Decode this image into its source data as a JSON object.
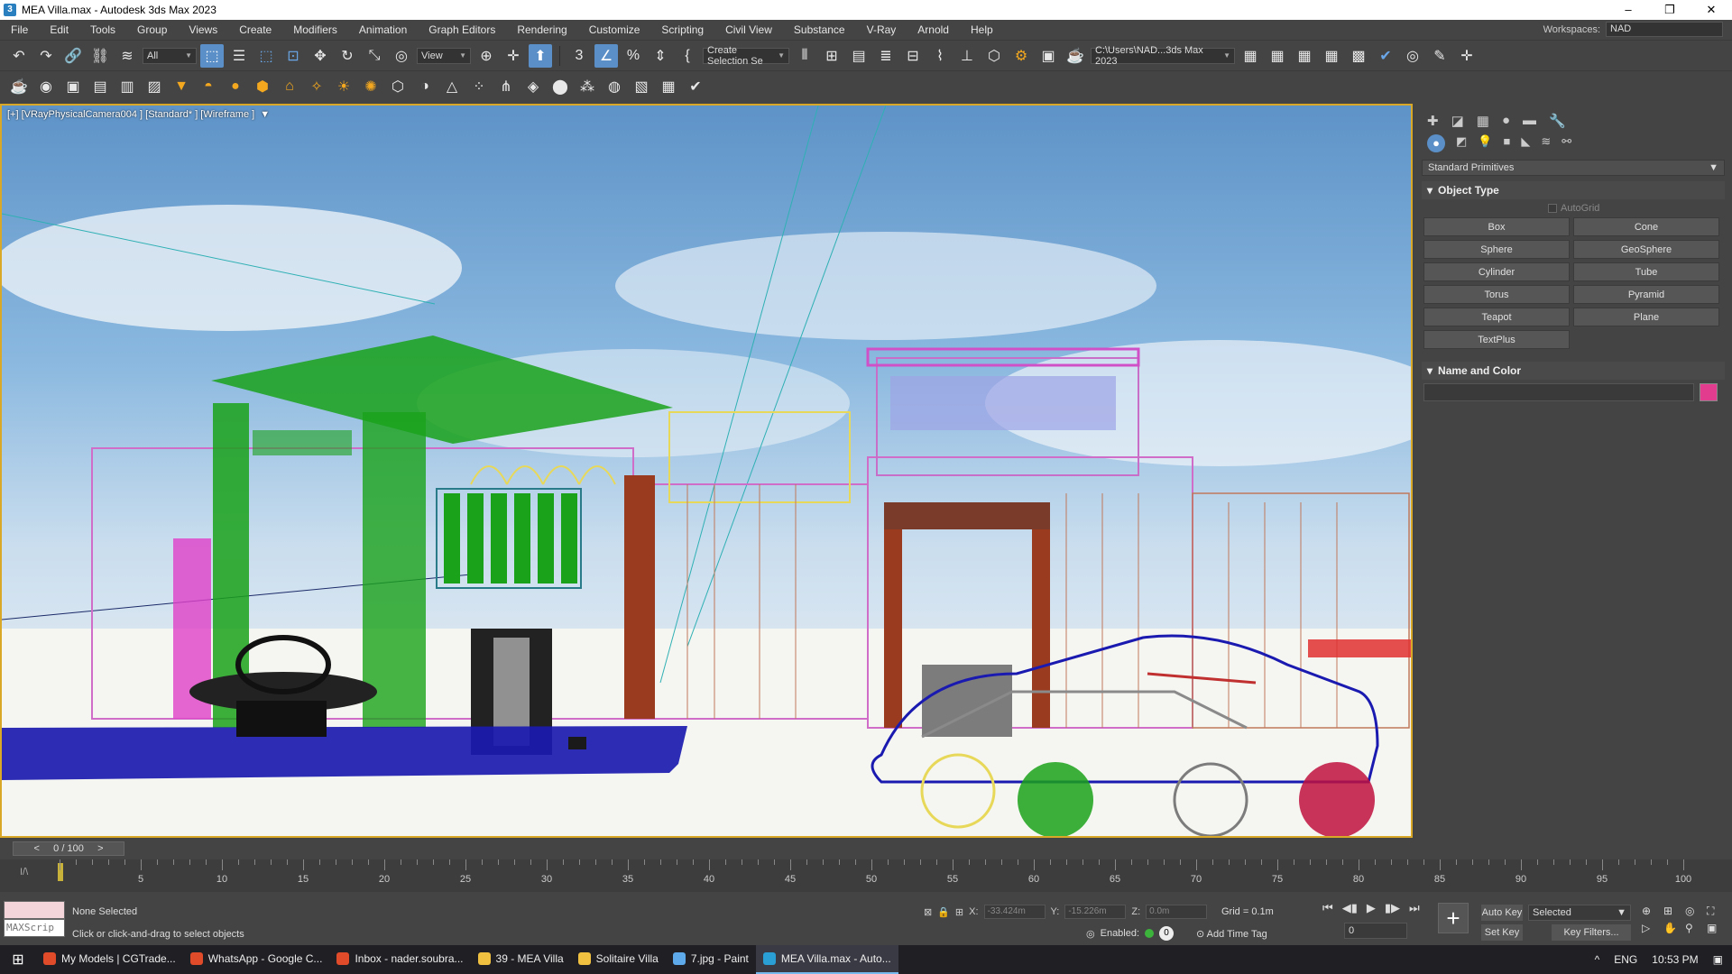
{
  "window": {
    "title": "MEA Villa.max - Autodesk 3ds Max 2023",
    "minimize": "–",
    "maximize": "❐",
    "close": "✕"
  },
  "menu": [
    "File",
    "Edit",
    "Tools",
    "Group",
    "Views",
    "Create",
    "Modifiers",
    "Animation",
    "Graph Editors",
    "Rendering",
    "Customize",
    "Scripting",
    "Civil View",
    "Substance",
    "V-Ray",
    "Arnold",
    "Help"
  ],
  "workspace": {
    "label": "Workspaces:",
    "value": "NAD"
  },
  "toolbar": {
    "filter": "All",
    "ref_coord": "View",
    "selection_set": "Create Selection Se",
    "project_path": "C:\\Users\\NAD...3ds Max 2023"
  },
  "viewport": {
    "label": "[+] [VRayPhysicalCamera004 ] [Standard* ] [Wireframe ]"
  },
  "command_panel": {
    "category": "Standard Primitives",
    "object_type": "Object Type",
    "autogrid": "AutoGrid",
    "primitives": [
      "Box",
      "Cone",
      "Sphere",
      "GeoSphere",
      "Cylinder",
      "Tube",
      "Torus",
      "Pyramid",
      "Teapot",
      "Plane",
      "TextPlus"
    ],
    "name_and_color": "Name and Color",
    "object_color": "#e23c8e"
  },
  "timeslider": {
    "position": "0 / 100",
    "prev": "<",
    "next": ">"
  },
  "trackbar": {
    "ticks": [
      5,
      10,
      15,
      20,
      25,
      30,
      35,
      40,
      45,
      50,
      55,
      60,
      65,
      70,
      75,
      80,
      85,
      90,
      95,
      100
    ]
  },
  "status": {
    "maxscript": "MAXScrip",
    "selection": "None Selected",
    "prompt": "Click or click-and-drag to select objects",
    "x_label": "X:",
    "x_value": "-33.424m",
    "y_label": "Y:",
    "y_value": "-15.226m",
    "z_label": "Z:",
    "z_value": "0.0m",
    "grid": "Grid = 0.1m",
    "enabled_label": "Enabled:",
    "enabled_value": "0",
    "add_time_tag": "Add Time Tag",
    "frame": "0",
    "auto_key": "Auto Key",
    "set_key": "Set Key",
    "key_mode": "Selected",
    "key_filters": "Key Filters..."
  },
  "taskbar": {
    "tasks": [
      {
        "label": "My Models | CGTrade...",
        "color": "#e04b2a"
      },
      {
        "label": "WhatsApp - Google C...",
        "color": "#e04b2a"
      },
      {
        "label": "Inbox - nader.soubra...",
        "color": "#e04b2a"
      },
      {
        "label": "39 - MEA Villa",
        "color": "#f0c040"
      },
      {
        "label": "Solitaire Villa",
        "color": "#f0c040"
      },
      {
        "label": "7.jpg - Paint",
        "color": "#5da9e9"
      },
      {
        "label": "MEA Villa.max - Auto...",
        "color": "#2a9fd6"
      }
    ],
    "language": "ENG",
    "time": "10:53 PM"
  }
}
